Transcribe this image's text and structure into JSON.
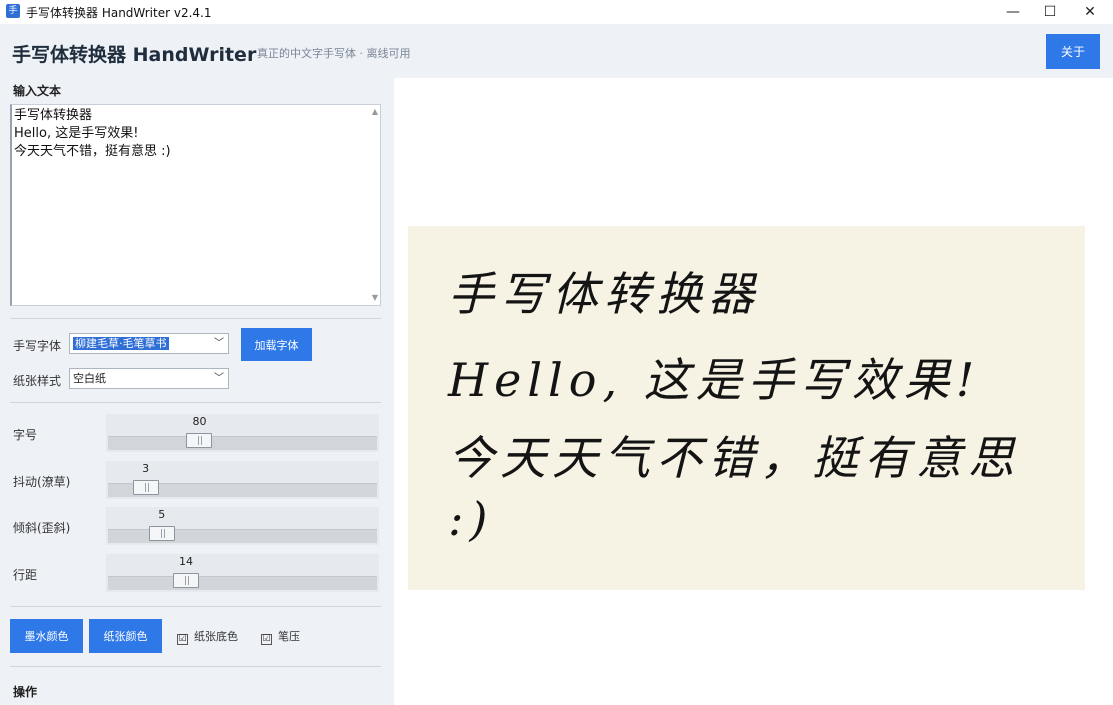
{
  "window": {
    "title": "手写体转换器 HandWriter v2.4.1",
    "icon_glyph": "手",
    "minimize": "—",
    "maximize": "☐",
    "close": "✕"
  },
  "header": {
    "title": "手写体转换器 HandWriter",
    "subtitle": "真正的中文字手写体 · 离线可用",
    "about_label": "关于"
  },
  "input": {
    "section_label": "输入文本",
    "text": "手写体转换器\nHello, 这是手写效果!\n今天天气不错，挺有意思 :)"
  },
  "font": {
    "label": "手写字体",
    "selected": "柳建毛草·毛笔草书",
    "load_label": "加载字体"
  },
  "paper_style": {
    "label": "纸张样式",
    "selected": "空白纸"
  },
  "sliders": [
    {
      "label": "字号",
      "value": "80",
      "fraction": 0.34
    },
    {
      "label": "抖动(潦草)",
      "value": "3",
      "fraction": 0.14
    },
    {
      "label": "倾斜(歪斜)",
      "value": "5",
      "fraction": 0.2
    },
    {
      "label": "行距",
      "value": "14",
      "fraction": 0.29
    }
  ],
  "colors": {
    "ink_label": "墨水颜色",
    "paper_label": "纸张颜色",
    "paper_bg_label": "纸张底色",
    "paper_bg_checked": "☑",
    "pressure_label": "笔压",
    "pressure_checked": "☑"
  },
  "actions": {
    "section_label": "操作"
  },
  "preview": {
    "lines": [
      "手写体转换器",
      "Hello, 这是手写效果!",
      "今天天气不错，挺有意思",
      ":)"
    ]
  }
}
